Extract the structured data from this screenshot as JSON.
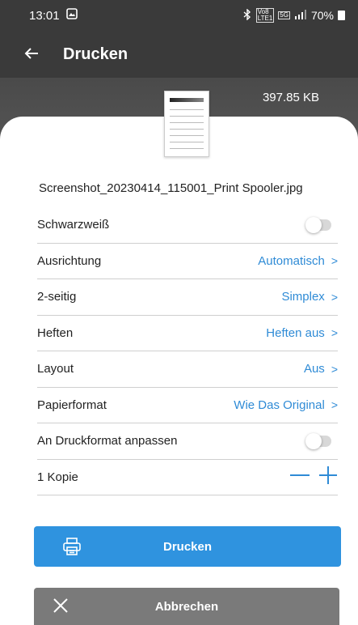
{
  "status_bar": {
    "time": "13:01",
    "network_top": "Vo8",
    "network_bottom": "LTE1",
    "signal_label": "5G",
    "battery": "70%"
  },
  "app_bar": {
    "title": "Drucken"
  },
  "file": {
    "size": "397.85 KB",
    "name": "Screenshot_20230414_115001_Print Spooler.jpg"
  },
  "settings": {
    "blackwhite": {
      "label": "Schwarzweiß",
      "on": false
    },
    "orientation": {
      "label": "Ausrichtung",
      "value": "Automatisch"
    },
    "duplex": {
      "label": "2-seitig",
      "value": "Simplex"
    },
    "staple": {
      "label": "Heften",
      "value": "Heften aus"
    },
    "layout": {
      "label": "Layout",
      "value": "Aus"
    },
    "paper": {
      "label": "Papierformat",
      "value": "Wie Das Original"
    },
    "fit": {
      "label": "An Druckformat anpassen",
      "on": false
    },
    "copies": {
      "label": "1 Kopie",
      "count": 1
    }
  },
  "actions": {
    "print_label": "Drucken",
    "cancel_label": "Abbrechen"
  },
  "colors": {
    "accent": "#2f8bd6",
    "primary_button": "#2f93df",
    "cancel_button": "#7a7a7a",
    "app_bar": "#3a3a3a"
  },
  "icons": {
    "back": "arrow-left-icon",
    "print": "printer-icon",
    "cancel": "close-icon",
    "chevron": "chevron-right-icon"
  }
}
